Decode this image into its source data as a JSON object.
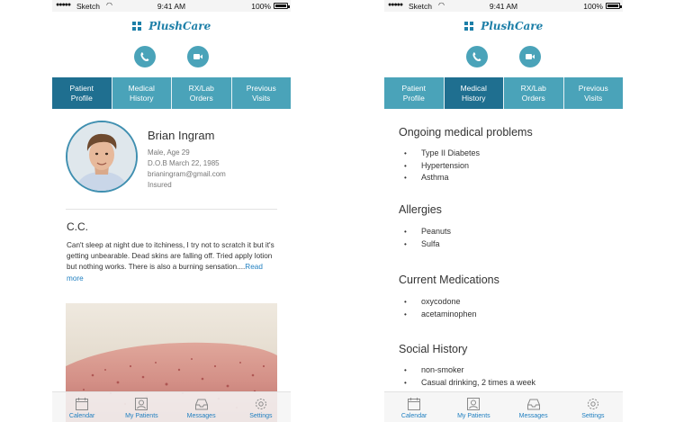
{
  "status": {
    "carrier": "Sketch",
    "time": "9:41 AM",
    "battery": "100%"
  },
  "brand": {
    "name": "PlushCare"
  },
  "colors": {
    "accent": "#4aa3b9",
    "accent_dark": "#1f6f90",
    "link": "#1f7fc0"
  },
  "tabs": [
    "Patient\nProfile",
    "Medical\nHistory",
    "RX/Lab\nOrders",
    "Previous\nVisits"
  ],
  "tab_labels": [
    {
      "l1": "Patient",
      "l2": "Profile"
    },
    {
      "l1": "Medical",
      "l2": "History"
    },
    {
      "l1": "RX/Lab",
      "l2": "Orders"
    },
    {
      "l1": "Previous",
      "l2": "Visits"
    }
  ],
  "patient": {
    "name": "Brian Ingram",
    "sex_age": "Male, Age 29",
    "dob": "D.O.B   March 22, 1985",
    "email": "brianingram@gmail.com",
    "insurance": "Insured"
  },
  "cc": {
    "title": "C.C.",
    "text": "Can't sleep at night due to itchiness, I try not to scratch it but it's getting unbearable. Dead skins are falling off. Tried apply lotion but nothing works. There is also a burning sensation....",
    "read_more": "Read more"
  },
  "history": {
    "ongoing": {
      "title": "Ongoing medical problems",
      "items": [
        "Type II Diabetes",
        "Hypertension",
        "Asthma"
      ]
    },
    "allergies": {
      "title": "Allergies",
      "items": [
        "Peanuts",
        "Sulfa"
      ]
    },
    "medications": {
      "title": "Current Medications",
      "items": [
        "oxycodone",
        "acetaminophen"
      ]
    },
    "social": {
      "title": "Social History",
      "items": [
        "non-smoker",
        "Casual drinking, 2 times a week"
      ]
    }
  },
  "bottom_nav": [
    {
      "label": "Calendar",
      "icon": "calendar-icon"
    },
    {
      "label": "My Patients",
      "icon": "patient-icon"
    },
    {
      "label": "Messages",
      "icon": "inbox-icon"
    },
    {
      "label": "Settings",
      "icon": "gear-icon"
    }
  ]
}
